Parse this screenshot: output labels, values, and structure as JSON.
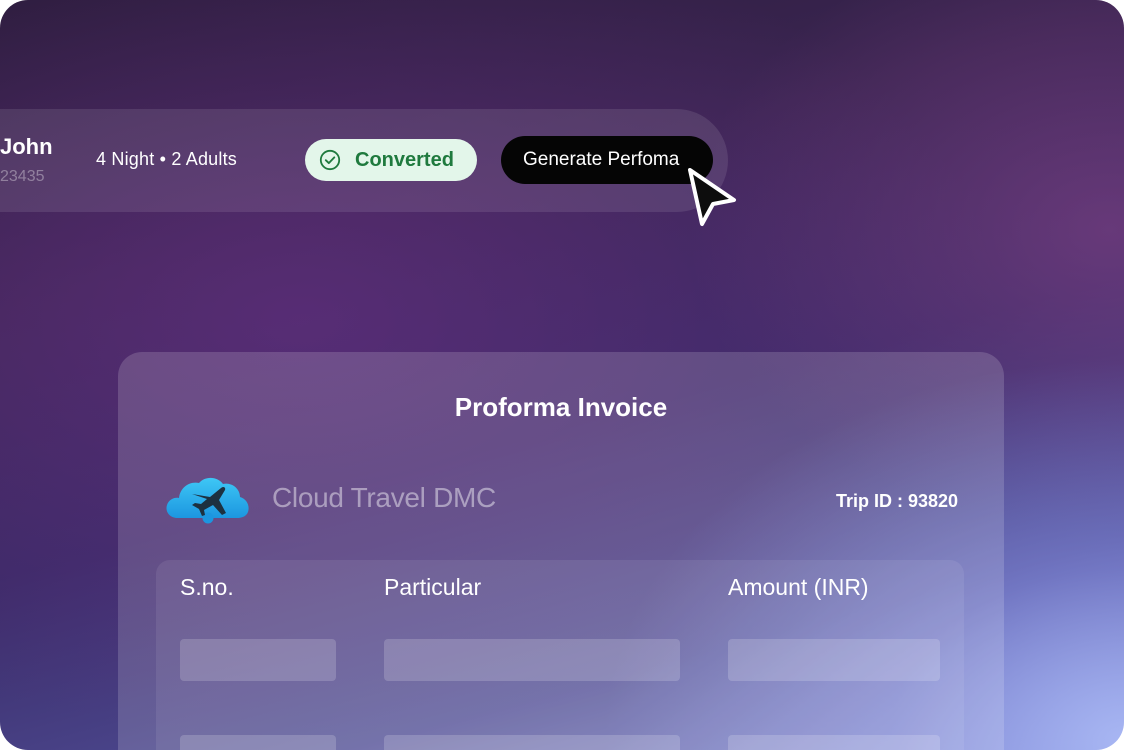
{
  "booking": {
    "customer_name": "John",
    "customer_id": "23435",
    "trip_summary": "4  Night • 2 Adults",
    "status_label": "Converted",
    "status_icon": "check-circle-icon",
    "generate_button_label": "Generate Perfoma"
  },
  "invoice": {
    "title": "Proforma Invoice",
    "company_name": "Cloud Travel DMC",
    "logo_icon": "cloud-plane-logo-icon",
    "trip_id_label": "Trip ID : 93820",
    "columns": [
      "S.no.",
      "Particular",
      "Amount (INR)"
    ]
  },
  "colors": {
    "status_bg": "#e3f6ea",
    "status_text": "#1f7a3e",
    "button_bg": "#050505",
    "logo_blue": "#1fa8e8"
  }
}
